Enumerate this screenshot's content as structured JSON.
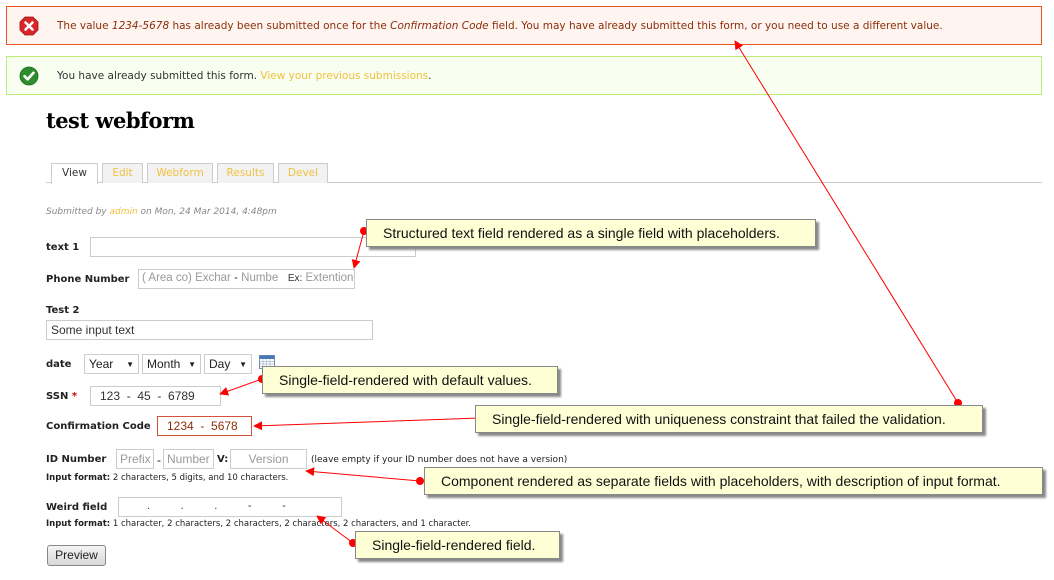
{
  "messages": {
    "error": {
      "icon": "error-icon",
      "prefix": "The value ",
      "value": "1234-5678",
      "middle": " has already been submitted once for the ",
      "field": "Confirmation Code",
      "suffix": " field. You may have already submitted this form, or you need to use a different value."
    },
    "status": {
      "icon": "check-icon",
      "text": "You have already submitted this form. ",
      "link": "View your previous submissions",
      "end": "."
    }
  },
  "page": {
    "title": "test webform"
  },
  "tabs": [
    {
      "label": "View",
      "active": true
    },
    {
      "label": "Edit"
    },
    {
      "label": "Webform"
    },
    {
      "label": "Results"
    },
    {
      "label": "Devel"
    }
  ],
  "submitted": {
    "prefix": "Submitted by ",
    "user": "admin",
    "suffix": " on Mon, 24 Mar 2014, 4:48pm"
  },
  "form": {
    "text1": {
      "label": "text 1",
      "value": ""
    },
    "phone": {
      "label": "Phone Number",
      "open": "(",
      "area": "Area co",
      "close": ")",
      "exchange": "Exchar",
      "dash": "-",
      "number": "Numbe",
      "ext_label": "Ex:",
      "ext": "Extention"
    },
    "test2": {
      "label": "Test 2",
      "value": "Some input text"
    },
    "date": {
      "label": "date",
      "year": "Year",
      "month": "Month",
      "day": "Day",
      "calendar_icon": "calendar-icon"
    },
    "ssn": {
      "label": "SSN",
      "required": "*",
      "value": "123  -  45  -  6789"
    },
    "confirmation": {
      "label": "Confirmation Code",
      "value": "1234  -  5678"
    },
    "id_number": {
      "label": "ID Number",
      "prefix_ph": "Prefix",
      "sep": "-",
      "number_ph": "Number",
      "v_label": "V:",
      "version_ph": "Version",
      "note": "(leave empty if your ID number does not have a version)",
      "format_label": "Input format:",
      "format": " 2 characters, 5 digits, and 10 characters."
    },
    "weird": {
      "label": "Weird field",
      "value": ".          .          .          -          -",
      "format_label": "Input format:",
      "format": " 1 character, 2 characters, 2 characters, 2 characters, 2 characters, and 1 character."
    },
    "preview_button": "Preview"
  },
  "annotations": [
    {
      "text": "Structured text field rendered as a single field with placeholders."
    },
    {
      "text": "Single-field-rendered with default values."
    },
    {
      "text": "Single-field-rendered with uniqueness constraint that failed the validation."
    },
    {
      "text": "Component rendered as separate fields with placeholders, with description of input format."
    },
    {
      "text": "Single-field-rendered field."
    }
  ],
  "colors": {
    "error_border": "#ed541d",
    "status_border": "#bbee77",
    "link": "#f0c040",
    "annotation_bg": "#ffffd6",
    "arrow": "#ff0000"
  }
}
